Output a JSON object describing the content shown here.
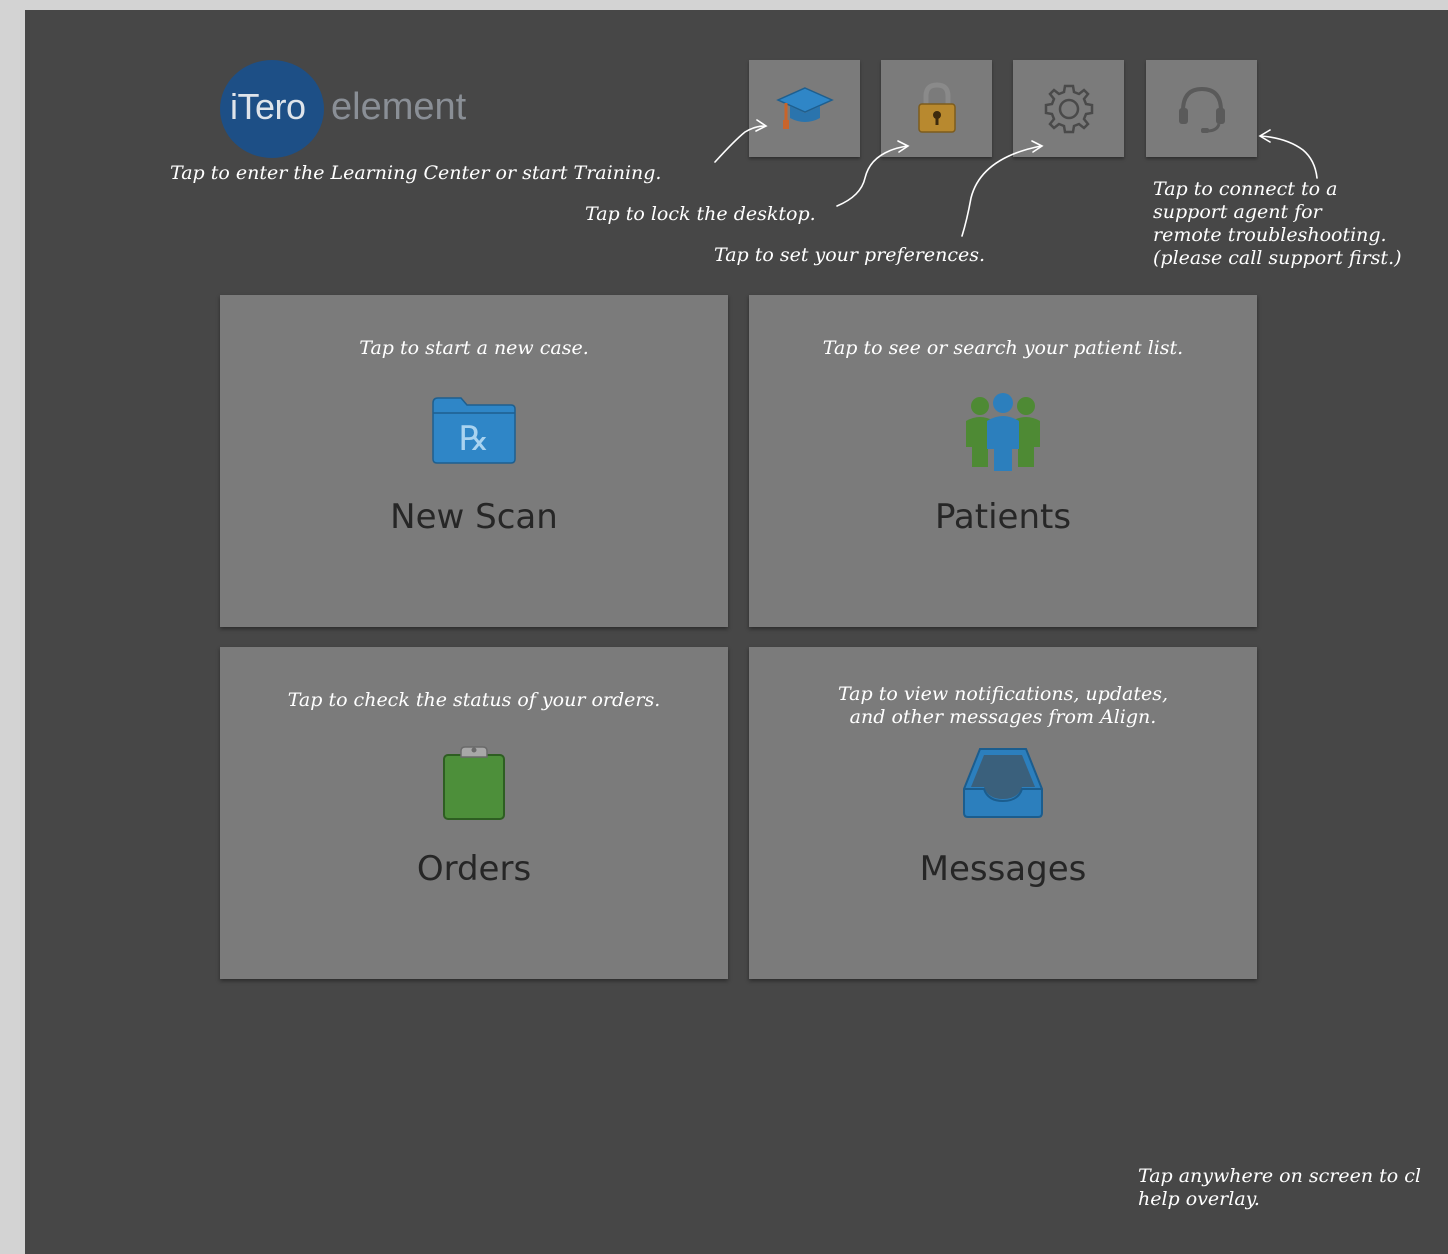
{
  "logo": {
    "brand": "iTero",
    "product": "element"
  },
  "toolbar": [
    {
      "id": "learning",
      "icon": "graduation-cap-icon"
    },
    {
      "id": "lock",
      "icon": "padlock-icon"
    },
    {
      "id": "settings",
      "icon": "gear-icon"
    },
    {
      "id": "support",
      "icon": "headset-icon"
    }
  ],
  "hints": {
    "learning": "Tap to enter the Learning Center or start Training.",
    "lock": "Tap to lock the desktop.",
    "preferences": "Tap to set your preferences.",
    "support": "Tap to connect to a\nsupport agent for\nremote troubleshooting.\n(please call support first.)",
    "close": "Tap anywhere on screen to cl\nhelp overlay."
  },
  "tiles": {
    "new_scan": {
      "label": "New Scan",
      "hint": "Tap to start a new case.",
      "icon": "rx-folder-icon"
    },
    "patients": {
      "label": "Patients",
      "hint": "Tap to see or search your patient list.",
      "icon": "patients-group-icon"
    },
    "orders": {
      "label": "Orders",
      "hint": "Tap to check the status of your orders.",
      "icon": "clipboard-icon"
    },
    "messages": {
      "label": "Messages",
      "hint": "Tap to view notifications, updates,\nand other messages from Align.",
      "icon": "inbox-tray-icon"
    }
  },
  "colors": {
    "overlay_bg": "#474747",
    "tile_bg": "#7b7b7b",
    "logo_circle": "#1d4f86",
    "folder_blue": "#2f86c7",
    "padlock_gold": "#b8892f",
    "clipboard_green": "#4d8f3a",
    "patient_green": "#4e8a34",
    "patient_blue": "#2c7fbd"
  }
}
